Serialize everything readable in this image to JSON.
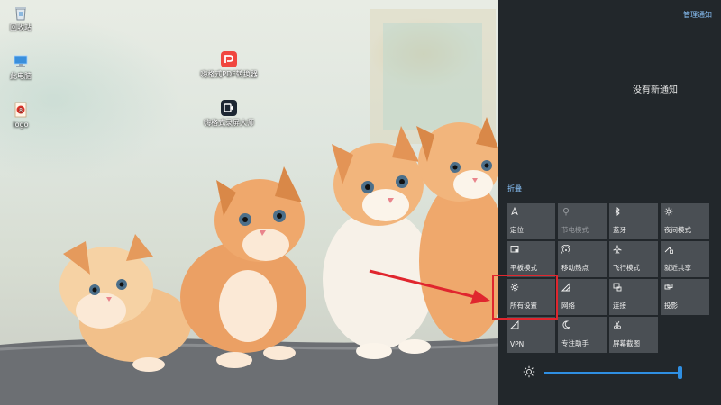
{
  "desktop": {
    "icons": [
      {
        "label": "回收站",
        "icon": "recycle-bin-icon"
      },
      {
        "label": "此电脑",
        "icon": "computer-icon"
      },
      {
        "label": "logo",
        "icon": "logo-file-icon"
      },
      {
        "label": "嗨格式PDF转换器",
        "icon": "pdf-converter-icon"
      },
      {
        "label": "嗨格式录屏大师",
        "icon": "screen-recorder-icon"
      }
    ]
  },
  "action_center": {
    "manage_label": "管理通知",
    "no_notifications": "没有新通知",
    "collapse_label": "折叠",
    "tiles": [
      {
        "label": "定位",
        "icon": "location-icon",
        "disabled": false
      },
      {
        "label": "节电模式",
        "icon": "battery-saver-icon",
        "disabled": true
      },
      {
        "label": "蓝牙",
        "icon": "bluetooth-icon",
        "disabled": false
      },
      {
        "label": "夜间模式",
        "icon": "night-light-icon",
        "disabled": false
      },
      {
        "label": "平板模式",
        "icon": "tablet-mode-icon",
        "disabled": false
      },
      {
        "label": "移动热点",
        "icon": "hotspot-icon",
        "disabled": false
      },
      {
        "label": "飞行模式",
        "icon": "airplane-icon",
        "disabled": false
      },
      {
        "label": "就近共享",
        "icon": "nearby-share-icon",
        "disabled": false
      },
      {
        "label": "所有设置",
        "icon": "gear-icon",
        "disabled": false
      },
      {
        "label": "网络",
        "icon": "network-icon",
        "disabled": false
      },
      {
        "label": "连接",
        "icon": "connect-icon",
        "disabled": false
      },
      {
        "label": "投影",
        "icon": "project-icon",
        "disabled": false
      },
      {
        "label": "VPN",
        "icon": "vpn-icon",
        "disabled": false
      },
      {
        "label": "专注助手",
        "icon": "focus-assist-icon",
        "disabled": false
      },
      {
        "label": "屏幕截图",
        "icon": "screen-snip-icon",
        "disabled": false
      }
    ],
    "brightness_level": 0.98
  },
  "colors": {
    "accent": "#2f8fe3",
    "link": "#8cc7ff",
    "panel": "#22272b",
    "tile": "#4a4f54",
    "highlight": "#e0262e"
  }
}
